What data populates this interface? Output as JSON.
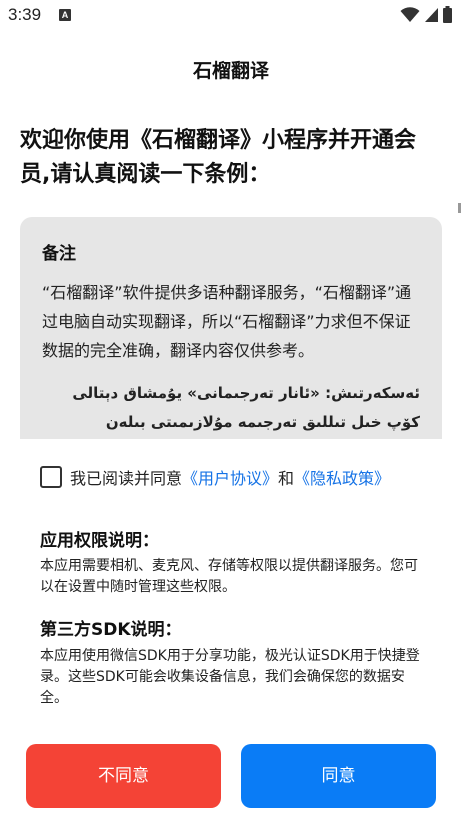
{
  "status_bar": {
    "time": "3:39",
    "notification_letter": "A"
  },
  "app": {
    "title": "石榴翻译"
  },
  "welcome": {
    "text": "欢迎你使用《石榴翻译》小程序并开通会员,请认真阅读一下条例："
  },
  "notice": {
    "heading": "备注",
    "body": "“石榴翻译”软件提供多语种翻译服务，“石榴翻译”通过电脑自动实现翻译，所以“石榴翻译”力求但不保证数据的完全准确，翻译内容仅供参考。",
    "uyghur": "ئەسكەرتىش: «ئانار تەرجىمانى» يۇمشاق دېتالى كۆپ خىل تىللىق تەرجىمە مۇلازىمىتى بىلەن تەمىنلەيدۇ، «ئانار"
  },
  "agreement": {
    "prefix": "我已阅读并同意",
    "user_agreement": "《用户协议》",
    "conjunction": "和",
    "privacy_policy": "《隐私政策》",
    "checked": false
  },
  "permissions": {
    "title": "应用权限说明：",
    "body": "本应用需要相机、麦克风、存储等权限以提供翻译服务。您可以在设置中随时管理这些权限。"
  },
  "sdk": {
    "title": "第三方SDK说明：",
    "body": "本应用使用微信SDK用于分享功能，极光认证SDK用于快捷登录。这些SDK可能会收集设备信息，我们会确保您的数据安全。"
  },
  "buttons": {
    "decline": "不同意",
    "agree": "同意"
  },
  "colors": {
    "decline": "#f44336",
    "agree": "#0a7cf6",
    "link": "#1673e6",
    "notice_bg": "#e6e6e6"
  }
}
